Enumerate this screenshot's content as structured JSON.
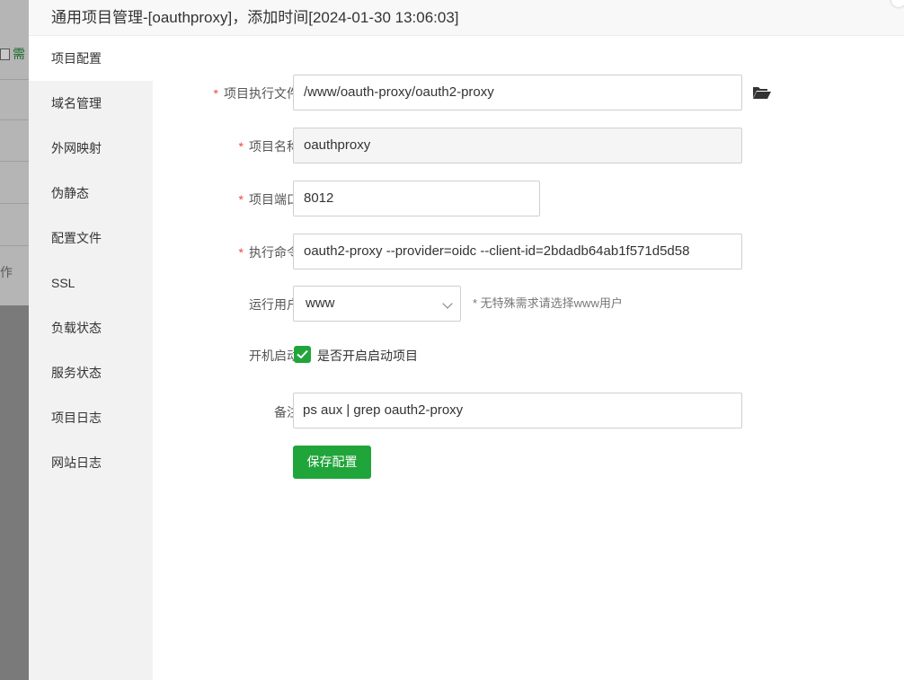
{
  "background": {
    "edit_label": "需",
    "op_label": "作"
  },
  "modal": {
    "title": "通用项目管理-[oauthproxy]，添加时间[2024-01-30 13:06:03]"
  },
  "sidebar": {
    "items": [
      {
        "label": "项目配置",
        "active": true
      },
      {
        "label": "域名管理"
      },
      {
        "label": "外网映射"
      },
      {
        "label": "伪静态"
      },
      {
        "label": "配置文件"
      },
      {
        "label": "SSL"
      },
      {
        "label": "负载状态"
      },
      {
        "label": "服务状态"
      },
      {
        "label": "项目日志"
      },
      {
        "label": "网站日志"
      }
    ]
  },
  "form": {
    "exec_file": {
      "label": "项目执行文件",
      "required": "*",
      "value": "/www/oauth-proxy/oauth2-proxy"
    },
    "project_name": {
      "label": "项目名称",
      "required": "*",
      "value": "oauthproxy"
    },
    "project_port": {
      "label": "项目端口",
      "required": "*",
      "value": "8012"
    },
    "exec_command": {
      "label": "执行命令",
      "required": "*",
      "value": "oauth2-proxy --provider=oidc --client-id=2bdadb64ab1f571d5d58"
    },
    "run_user": {
      "label": "运行用户",
      "value": "www",
      "hint": "* 无特殊需求请选择www用户"
    },
    "autostart": {
      "label": "开机启动",
      "checkbox_label": "是否开启启动项目",
      "checked": true
    },
    "remark": {
      "label": "备注",
      "value": "ps aux | grep oauth2-proxy"
    },
    "save_label": "保存配置"
  },
  "colors": {
    "accent": "#20a53a",
    "required": "#e74c3c"
  }
}
